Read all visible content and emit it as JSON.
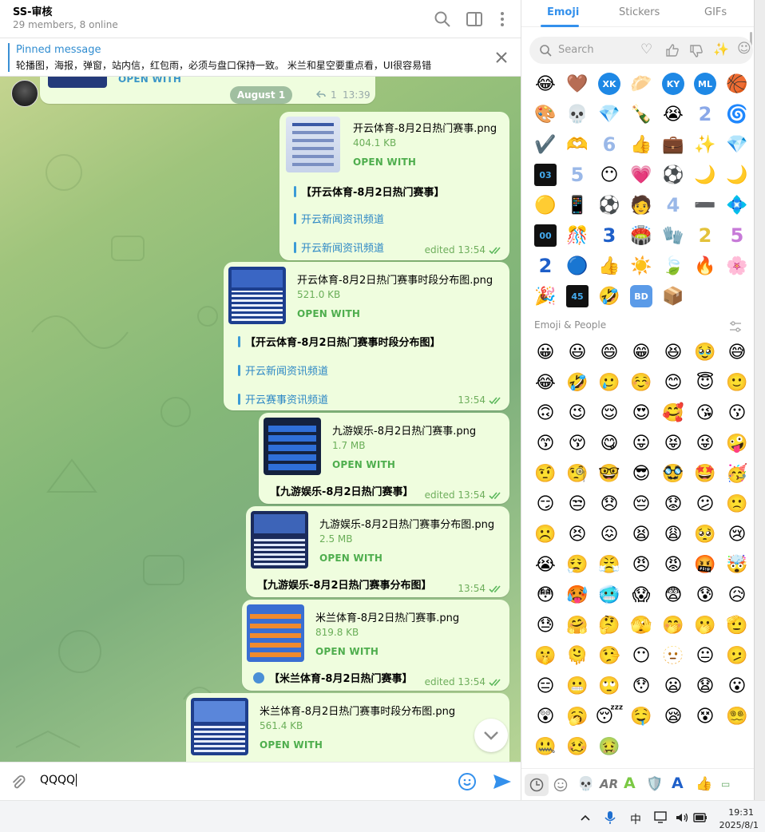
{
  "header": {
    "title": "SS-审核",
    "subtitle": "29 members, 8 online"
  },
  "pinned": {
    "label": "Pinned message",
    "text": "轮播图，海报，弹窗，站内信，红包雨，必须与盘口保持一致。 米兰和星空要重点看，UI很容易错"
  },
  "chat": {
    "date_pill": "August 1",
    "top_partial": {
      "open": "OPEN WITH",
      "replies": "1",
      "time": "13:39"
    },
    "messages": [
      {
        "file": "开云体育-8月2日热门赛事.png",
        "size": "404.1 KB",
        "open": "OPEN WITH",
        "lines": [
          "【开云体育-8月2日热门赛事】",
          "开云新闻资讯频道",
          "开云新闻资讯频道"
        ],
        "meta": "edited 13:54"
      },
      {
        "file": "开云体育-8月2日热门赛事时段分布图.png",
        "size": "521.0 KB",
        "open": "OPEN WITH",
        "lines": [
          "【开云体育-8月2日热门赛事时段分布图】",
          "开云新闻资讯频道",
          "开云赛事资讯频道"
        ],
        "meta": "13:54"
      },
      {
        "file": "九游娱乐-8月2日热门赛事.png",
        "size": "1.7 MB",
        "open": "OPEN WITH",
        "lines": [
          "【九游娱乐-8月2日热门赛事】"
        ],
        "meta": "edited 13:54"
      },
      {
        "file": "九游娱乐-8月2日热门赛事分布图.png",
        "size": "2.5 MB",
        "open": "OPEN WITH",
        "lines": [
          "【九游娱乐-8月2日热门赛事分布图】"
        ],
        "meta": "13:54"
      },
      {
        "file": "米兰体育-8月2日热门赛事.png",
        "size": "819.8 KB",
        "open": "OPEN WITH",
        "lines": [
          "【米兰体育-8月2日热门赛事】"
        ],
        "meta": "edited 13:54"
      },
      {
        "file": "米兰体育-8月2日热门赛事时段分布图.png",
        "size": "561.4 KB",
        "open": "OPEN WITH",
        "lines": [],
        "meta": ""
      }
    ]
  },
  "composer": {
    "value": "QQQQ"
  },
  "panel": {
    "tabs": [
      "Emoji",
      "Stickers",
      "GIFs"
    ],
    "search_placeholder": "Search",
    "recent_labels": [
      "XK",
      "KY",
      "ML",
      "BD",
      "2",
      "6",
      "5",
      "3",
      "4",
      "2",
      "5",
      "2",
      "03",
      "00",
      "45"
    ],
    "section_title": "Emoji & People"
  },
  "taskbar": {
    "ime": "中",
    "time": "19:31",
    "date": "2025/8/1"
  },
  "colors": {
    "accent": "#3390ec",
    "bubble": "#effdde",
    "meta_green": "#4fae4e",
    "link": "#2e88c5"
  }
}
